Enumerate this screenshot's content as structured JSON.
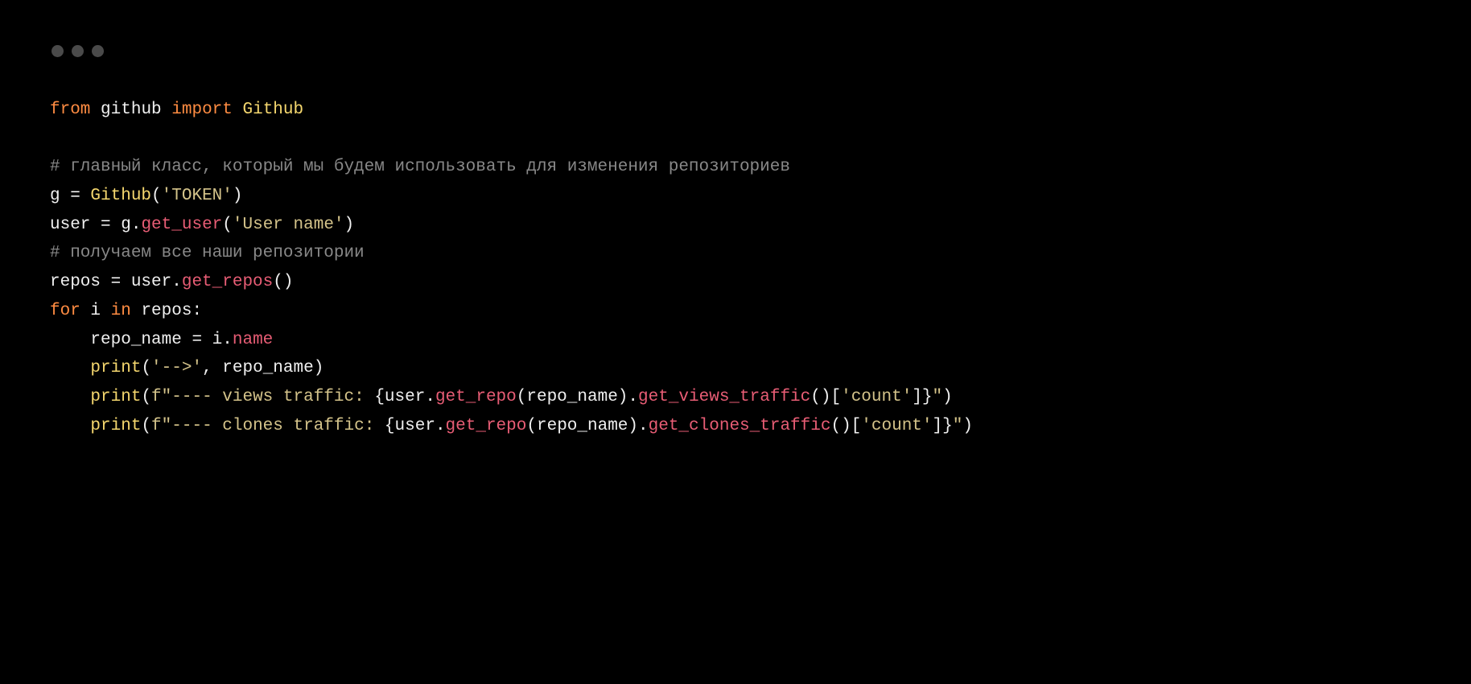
{
  "code": {
    "line1": {
      "from": "from",
      "module": "github",
      "import": "import",
      "cls": "Github"
    },
    "line3": {
      "comment": "# главный класс, который мы будем использовать для изменения репозиториев"
    },
    "line4": {
      "var": "g",
      "eq": " = ",
      "cls": "Github",
      "open": "(",
      "q1": "'",
      "token": "TOKEN",
      "q2": "'",
      "close": ")"
    },
    "line5": {
      "var": "user",
      "eq": " = ",
      "obj": "g.",
      "fn": "get_user",
      "open": "(",
      "q1": "'",
      "arg": "User name",
      "q2": "'",
      "close": ")"
    },
    "line6": {
      "comment": "# получаем все наши репозитории"
    },
    "line7": {
      "var": "repos",
      "eq": " = ",
      "obj": "user.",
      "fn": "get_repos",
      "call": "()"
    },
    "line8": {
      "for": "for",
      "i": " i ",
      "in": "in",
      "repos": " repos",
      "colon": ":"
    },
    "line9": {
      "indent": "    ",
      "var": "repo_name",
      "eq": " = ",
      "obj": "i.",
      "attr": "name"
    },
    "line10": {
      "indent": "    ",
      "print": "print",
      "open": "(",
      "q1": "'",
      "arrow": "-->",
      "q2": "'",
      "comma": ", ",
      "arg": "repo_name",
      "close": ")"
    },
    "line11": {
      "indent": "    ",
      "print": "print",
      "open": "(",
      "f": "f",
      "q1": "\"",
      "text1": "---- views traffic: ",
      "lbrace": "{",
      "expr_user": "user.",
      "expr_fn1": "get_repo",
      "expr_open1": "(",
      "expr_arg": "repo_name",
      "expr_close1": ").",
      "expr_fn2": "get_views_traffic",
      "expr_call": "()[",
      "expr_q1": "'",
      "expr_key": "count",
      "expr_q2": "'",
      "expr_close2": "]",
      "rbrace": "}",
      "q2": "\"",
      "close": ")"
    },
    "line12": {
      "indent": "    ",
      "print": "print",
      "open": "(",
      "f": "f",
      "q1": "\"",
      "text1": "---- clones traffic: ",
      "lbrace": "{",
      "expr_user": "user.",
      "expr_fn1": "get_repo",
      "expr_open1": "(",
      "expr_arg": "repo_name",
      "expr_close1": ").",
      "expr_fn2": "get_clones_traffic",
      "expr_call": "()[",
      "expr_q1": "'",
      "expr_key": "count",
      "expr_q2": "'",
      "expr_close2": "]",
      "rbrace": "}",
      "q2": "\"",
      "close": ")"
    }
  }
}
